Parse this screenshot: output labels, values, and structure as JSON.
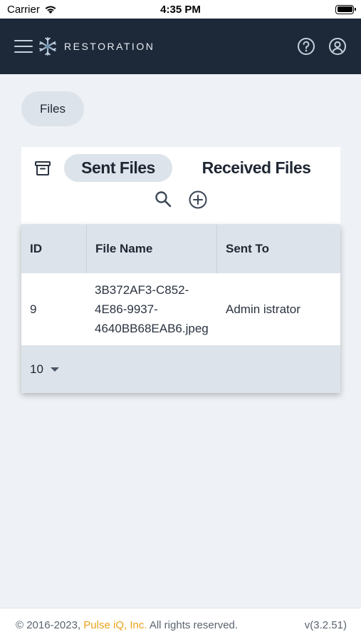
{
  "status_bar": {
    "carrier": "Carrier",
    "time": "4:35 PM"
  },
  "header": {
    "brand": "RESTORATION",
    "icons": [
      "menu-icon",
      "restoration-logo",
      "help-icon",
      "user-account-icon"
    ]
  },
  "breadcrumb": {
    "files_label": "Files"
  },
  "tabs": {
    "sent_label": "Sent Files",
    "received_label": "Received Files",
    "active": "Sent Files",
    "icons": [
      "archive-icon",
      "search-icon",
      "add-circle-icon"
    ]
  },
  "table": {
    "headers": [
      "ID",
      "File Name",
      "Sent To"
    ],
    "rows": [
      {
        "id": "9",
        "file_name_lines": [
          "3B372AF3-C852-",
          "4E86-9937-",
          "4640BB68EAB6.jpeg"
        ],
        "sent_to": "Admin istrator"
      }
    ],
    "page_size": "10"
  },
  "footer": {
    "copyright_prefix": "© 2016-2023, ",
    "company": "Pulse iQ, Inc.",
    "copyright_suffix": " All rights reserved.",
    "version": "v(3.2.51)"
  },
  "colors": {
    "header_bg": "#1d2838",
    "page_bg": "#eef2f6",
    "chip_bg": "#dde3ea",
    "accent_link": "#e8a21a"
  }
}
